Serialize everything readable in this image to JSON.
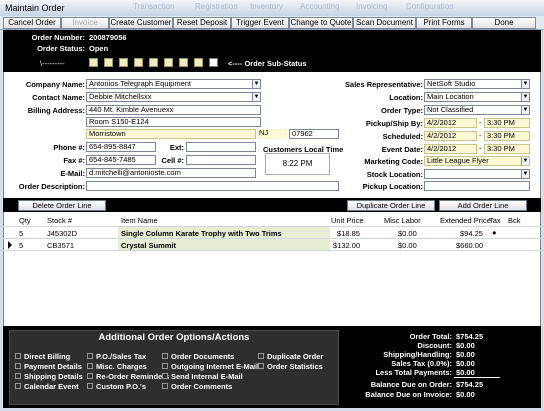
{
  "window": {
    "title": "Maintain Order",
    "ghost_tabs": [
      "Transaction",
      "Registration",
      "Inventory",
      "Accounting",
      "Invoicing",
      "Configuration"
    ]
  },
  "toolbar": {
    "cancel": "Cancel Order",
    "invoice": "Invoice",
    "create_customer": "Create Customer",
    "reset_deposit": "Reset Deposit",
    "trigger_event": "Trigger Event",
    "change_to_quote": "Change to Quote",
    "scan_document": "Scan Document",
    "print_forms": "Print Forms",
    "done": "Done"
  },
  "order": {
    "number_label": "Order Number:",
    "number": "200879056",
    "status_label": "Order Status:",
    "status": "Open",
    "dash_label": "\\---------",
    "substatus_label": "<---- Order Sub-Status"
  },
  "customer": {
    "company_label": "Company Name:",
    "company": "Antonios Telegraph Equipment",
    "contact_label": "Contact Name:",
    "contact": "Debbie Mitchellsxx",
    "billing_label": "Billing Address:",
    "address1": "440 Mt. Kimble Avenuexx",
    "address2": "Room S150-E124",
    "city": "Morristown",
    "state": "NJ",
    "zip": "07962",
    "phone_label": "Phone #:",
    "phone": "654-895-8847",
    "ext_label": "Ext:",
    "ext": "",
    "fax_label": "Fax #:",
    "fax": "654-845-7485",
    "cell_label": "Cell #:",
    "cell": "",
    "email_label": "E-Mail:",
    "email": "d.mitchelli@antonioste.com",
    "desc_label": "Order Description:",
    "desc": "",
    "local_time_label": "Customers Local Time",
    "local_time": "8:22 PM"
  },
  "right": {
    "salesrep_label": "Sales Representative:",
    "salesrep": "NetSoft Studio",
    "location_label": "Location:",
    "location": "Main Location",
    "ordertype_label": "Order Type:",
    "ordertype": "Not Classified",
    "pickup_label": "Pickup/Ship By:",
    "pickup_date": "4/2/2012",
    "pickup_time": "3:30 PM",
    "scheduled_label": "Scheduled:",
    "scheduled_date": "4/2/2012",
    "scheduled_time": "3:30 PM",
    "event_label": "Event Date:",
    "event_date": "4/2/2012",
    "event_time": "3:30 PM",
    "marketing_label": "Marketing Code:",
    "marketing": "Little League Flyer",
    "stock_label": "Stock Location:",
    "stock": "",
    "pickloc_label": "Pickup Location:",
    "pickloc": ""
  },
  "lines": {
    "delete_label": "Delete Order Line",
    "duplicate_label": "Duplicate Order Line",
    "add_label": "Add Order Line"
  },
  "grid": {
    "headers": {
      "qty": "Qty",
      "stock": "Stock #",
      "item": "Item Name",
      "unit": "Unit Price",
      "misc": "Misc Labor",
      "ext": "Extended Price",
      "tax": "Tax",
      "bck": "Bck"
    },
    "rows": [
      {
        "qty": "5",
        "stock": "J45302D",
        "item": "Single Column Karate Trophy with Two Trims",
        "unit": "$18.85",
        "misc": "$0.00",
        "ext": "$94.25",
        "tax": "●"
      },
      {
        "qty": "5",
        "stock": "CB3571",
        "item": "Crystal Summit",
        "unit": "$132.00",
        "misc": "$0.00",
        "ext": "$660.00",
        "tax": ""
      }
    ]
  },
  "additional": {
    "title": "Additional Order Options/Actions",
    "options": [
      "Direct Billing",
      "Payment Details",
      "Shipping Details",
      "Calendar Event",
      "P.O./Sales Tax",
      "Misc. Charges",
      "Re-Order Reminders",
      "Custom P.O.'s",
      "Order Documents",
      "Outgoing Internet E-Mails",
      "Send Internal E-Mail",
      "Order Comments",
      "Duplicate Order",
      "Order Statistics"
    ]
  },
  "totals": [
    {
      "label": "Order Total:",
      "value": "$754.25"
    },
    {
      "label": "Discount:",
      "value": "$0.00"
    },
    {
      "label": "Shipping/Handling:",
      "value": "$0.00"
    },
    {
      "label": "Sales Tax (0.0%):",
      "value": "$0.00"
    },
    {
      "label": "Less Total Payments:",
      "value": "$0.00"
    },
    {
      "label": "Balance Due on Order:",
      "value": "$754.25"
    },
    {
      "label": "Balance Due on Invoice:",
      "value": "$0.00"
    }
  ]
}
